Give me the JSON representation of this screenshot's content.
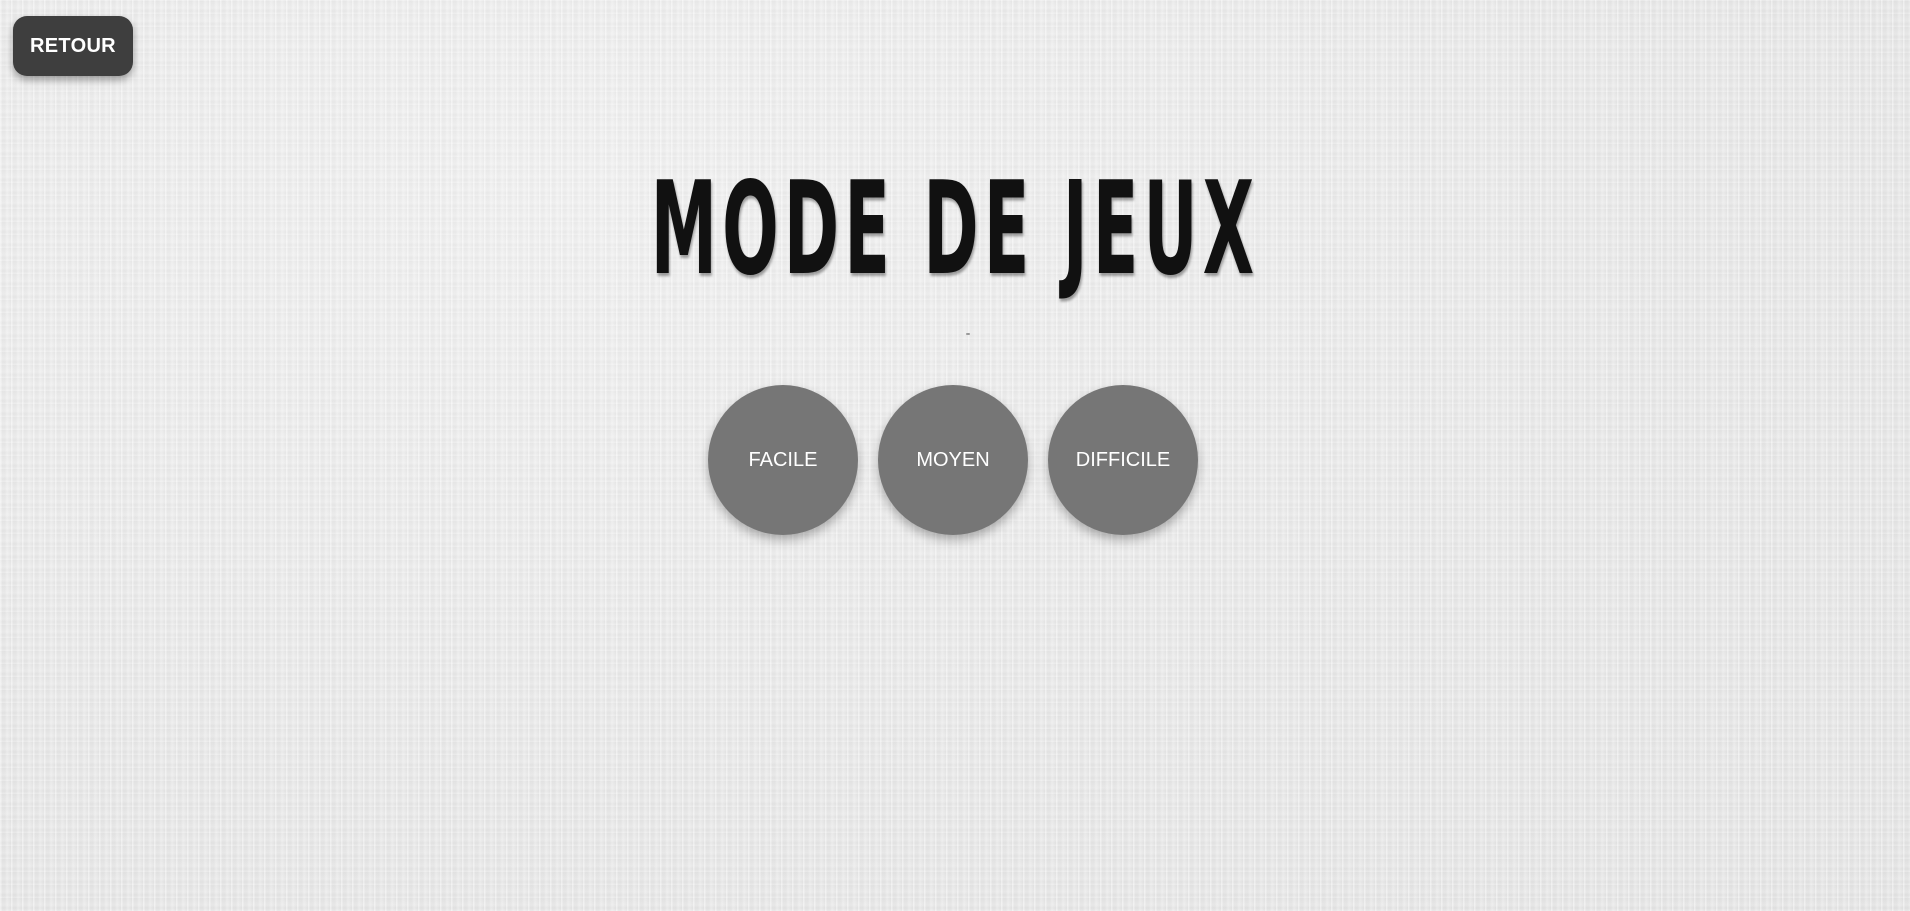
{
  "header": {
    "back_label": "RETOUR"
  },
  "main": {
    "title": "MODE DE JEUX",
    "difficulties": [
      {
        "label": "FACILE"
      },
      {
        "label": "MOYEN"
      },
      {
        "label": "DIFFICILE"
      }
    ]
  },
  "colors": {
    "background": "#ebebeb",
    "back_button": "#3e3e3e",
    "difficulty_button": "#767676",
    "title_text": "#111111",
    "button_text": "#ffffff"
  }
}
